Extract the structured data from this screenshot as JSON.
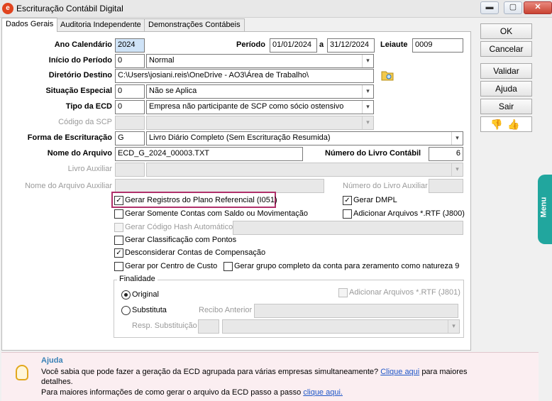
{
  "window": {
    "title": "Escrituração Contábil Digital",
    "app_icon": "chart-logo-icon",
    "close_glyph": "✕",
    "min_glyph": "▬",
    "restore_glyph": "▢"
  },
  "tabs": [
    {
      "label": "Dados Gerais",
      "active": true
    },
    {
      "label": "Auditoria Independente",
      "active": false
    },
    {
      "label": "Demonstrações Contábeis",
      "active": false
    }
  ],
  "form": {
    "ano_calendario": {
      "label": "Ano Calendário",
      "value": "2024"
    },
    "periodo": {
      "label": "Período",
      "start": "01/01/2024",
      "sep": "a",
      "end": "31/12/2024"
    },
    "leiaute": {
      "label": "Leiaute",
      "value": "0009"
    },
    "inicio_periodo": {
      "label": "Início do Período",
      "code": "0",
      "value": "Normal"
    },
    "diretorio_destino": {
      "label": "Diretório Destino",
      "value": "C:\\Users\\josiani.reis\\OneDrive - AO3\\Área de Trabalho\\"
    },
    "situacao_especial": {
      "label": "Situação Especial",
      "code": "0",
      "value": "Não se Aplica"
    },
    "tipo_ecd": {
      "label": "Tipo da ECD",
      "code": "0",
      "value": "Empresa não participante de SCP como sócio ostensivo"
    },
    "codigo_scp": {
      "label": "Código da SCP",
      "value": ""
    },
    "forma_escrituracao": {
      "label": "Forma de Escrituração",
      "code": "G",
      "value": "Livro Diário Completo (Sem Escrituração Resumida)"
    },
    "nome_arquivo": {
      "label": "Nome do Arquivo",
      "value": "ECD_G_2024_00003.TXT"
    },
    "numero_livro": {
      "label": "Número do Livro Contábil",
      "value": "6"
    },
    "livro_auxiliar": {
      "label": "Livro Auxiliar",
      "value": ""
    },
    "nome_arquivo_auxiliar": {
      "label": "Nome do Arquivo Auxiliar",
      "value": ""
    },
    "numero_livro_auxiliar": {
      "label": "Número do Livro Auxiliar",
      "value": ""
    }
  },
  "checks": {
    "plano_referencial": {
      "label": "Gerar Registros do Plano Referencial (I051)",
      "checked": true
    },
    "dmpl": {
      "label": "Gerar DMPL",
      "checked": true
    },
    "somente_contas": {
      "label": "Gerar Somente Contas com Saldo ou Movimentação",
      "checked": false
    },
    "rtf_j800": {
      "label": "Adicionar Arquivos *.RTF (J800)",
      "checked": false
    },
    "hash": {
      "label": "Gerar Código Hash Automático",
      "checked": false
    },
    "classificacao_pontos": {
      "label": "Gerar Classificação com Pontos",
      "checked": false
    },
    "desconsiderar": {
      "label": "Desconsiderar Contas de Compensação",
      "checked": true
    },
    "centro_custo": {
      "label": "Gerar por Centro de Custo",
      "checked": false
    },
    "grupo_completo": {
      "label": "Gerar grupo completo da conta para zeramento como natureza 9",
      "checked": false
    }
  },
  "finalidade": {
    "title": "Finalidade",
    "original": "Original",
    "substituta": "Substituta",
    "rtf_j801": "Adicionar Arquivos *.RTF (J801)",
    "recibo_anterior": "Recibo Anterior",
    "resp_substituicao": "Resp. Substituição",
    "selected": "Original"
  },
  "buttons": {
    "ok": "OK",
    "cancelar": "Cancelar",
    "validar": "Validar",
    "ajuda": "Ajuda",
    "sair": "Sair"
  },
  "feedback": {
    "dislike": "👎",
    "like": "👍"
  },
  "side_tab": "Menu",
  "help": {
    "title": "Ajuda",
    "line1": "Você sabia que pode fazer a geração da ECD agrupada para várias empresas simultaneamente?",
    "link1": "Clique aqui",
    "line1_end": "para maiores",
    "line2": "detalhes.",
    "line3": "Para maiores informações de como gerar o arquivo da ECD passo a passo",
    "link2": "clique aqui."
  },
  "check_glyph": "✓",
  "arrow_glyph": "▾"
}
